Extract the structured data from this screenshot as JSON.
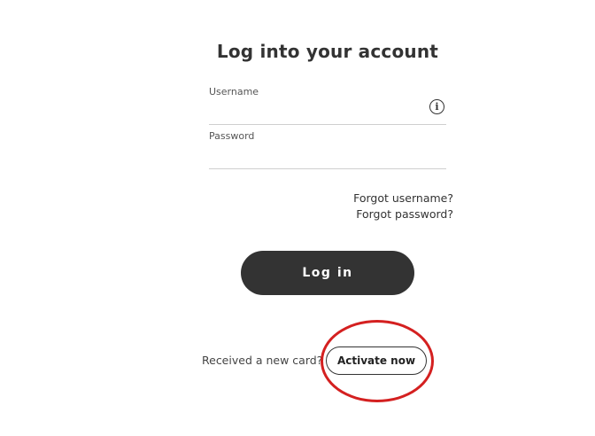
{
  "login": {
    "title": "Log into your account",
    "username": {
      "label": "Username",
      "value": "",
      "info_icon": "info-circle-icon"
    },
    "password": {
      "label": "Password",
      "value": ""
    },
    "forgot_username": "Forgot username?",
    "forgot_password": "Forgot password?",
    "login_button": "Log in"
  },
  "activation": {
    "prompt": "Received a new card?",
    "button": "Activate now",
    "highlight_color": "#d42020"
  },
  "colors": {
    "primary": "#333333",
    "background": "#ffffff"
  }
}
